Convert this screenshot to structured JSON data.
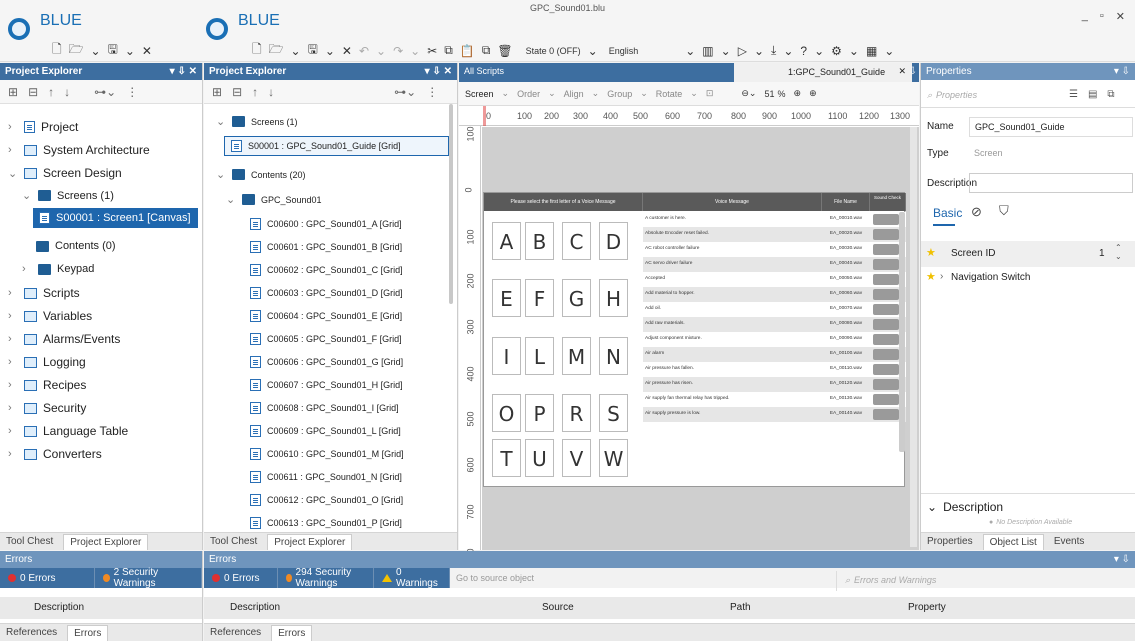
{
  "window": {
    "title": "GPC_Sound01.blu",
    "controls": [
      "_",
      "▫",
      "✕"
    ]
  },
  "brand": {
    "name": "BLUE"
  },
  "toolbar": {
    "state": "State 0 (OFF)",
    "language": "English"
  },
  "left_panel": {
    "title": "Project Explorer",
    "items": [
      {
        "label": "Project"
      },
      {
        "label": "System Architecture"
      },
      {
        "label": "Screen Design"
      },
      {
        "label": "Screens (1)"
      },
      {
        "label": "S00001 : Screen1 [Canvas]"
      },
      {
        "label": "Contents (0)"
      },
      {
        "label": "Keypad"
      },
      {
        "label": "Scripts"
      },
      {
        "label": "Variables"
      },
      {
        "label": "Alarms/Events"
      },
      {
        "label": "Logging"
      },
      {
        "label": "Recipes"
      },
      {
        "label": "Security"
      },
      {
        "label": "Language Table"
      },
      {
        "label": "Converters"
      }
    ],
    "tabs": [
      "Tool Chest",
      "Project Explorer"
    ]
  },
  "mid_panel": {
    "title": "Project Explorer",
    "screens": "Screens (1)",
    "screen_item": "S00001 : GPC_Sound01_Guide [Grid]",
    "contents": "Contents (20)",
    "group": "GPC_Sound01",
    "items": [
      "C00600 : GPC_Sound01_A [Grid]",
      "C00601 : GPC_Sound01_B [Grid]",
      "C00602 : GPC_Sound01_C [Grid]",
      "C00603 : GPC_Sound01_D [Grid]",
      "C00604 : GPC_Sound01_E [Grid]",
      "C00605 : GPC_Sound01_F [Grid]",
      "C00606 : GPC_Sound01_G [Grid]",
      "C00607 : GPC_Sound01_H [Grid]",
      "C00608 : GPC_Sound01_I [Grid]",
      "C00609 : GPC_Sound01_L [Grid]",
      "C00610 : GPC_Sound01_M [Grid]",
      "C00611 : GPC_Sound01_N [Grid]",
      "C00612 : GPC_Sound01_O [Grid]",
      "C00613 : GPC_Sound01_P [Grid]"
    ],
    "tabs": [
      "Tool Chest",
      "Project Explorer"
    ]
  },
  "editor": {
    "tab_all": "All Scripts",
    "tab_active": "1:GPC_Sound01_Guide",
    "toolbar": {
      "screen": "Screen",
      "order": "Order",
      "align": "Align",
      "group": "Group",
      "rotate": "Rotate",
      "zoom": "51",
      "zoom_unit": "%"
    },
    "hruler": [
      "0",
      "100",
      "200",
      "300",
      "400",
      "500",
      "600",
      "700",
      "800",
      "900",
      "1000",
      "1100",
      "1200",
      "1300"
    ],
    "vruler": [
      "100",
      "0",
      "100",
      "200",
      "300",
      "400",
      "500",
      "600",
      "700",
      "800"
    ],
    "grid": {
      "headers": [
        "Please select the first letter of a Voice Message",
        "Voice Message",
        "File Name",
        "Sound Check"
      ],
      "letters": [
        "A",
        "B",
        "C",
        "D",
        "E",
        "F",
        "G",
        "H",
        "I",
        "L",
        "M",
        "N",
        "O",
        "P",
        "R",
        "S",
        "T",
        "U",
        "V",
        "W"
      ],
      "messages": [
        {
          "msg": "A customer is here.",
          "file": "EA_00010.wav"
        },
        {
          "msg": "Absolute Encoder reset failed.",
          "file": "EA_00020.wav"
        },
        {
          "msg": "AC robot controller failure",
          "file": "EA_00030.wav"
        },
        {
          "msg": "AC servo driver failure",
          "file": "EA_00040.wav"
        },
        {
          "msg": "Accepted",
          "file": "EA_00050.wav"
        },
        {
          "msg": "Add material to hopper.",
          "file": "EA_00060.wav"
        },
        {
          "msg": "Add oil.",
          "file": "EA_00070.wav"
        },
        {
          "msg": "Add raw materials.",
          "file": "EA_00080.wav"
        },
        {
          "msg": "Adjust component mixture.",
          "file": "EA_00090.wav"
        },
        {
          "msg": "Air alarm",
          "file": "EA_00100.wav"
        },
        {
          "msg": "Air pressure has fallen.",
          "file": "EA_00110.wav"
        },
        {
          "msg": "Air pressure has risen.",
          "file": "EA_00120.wav"
        },
        {
          "msg": "Air supply fan thermal relay has tripped.",
          "file": "EA_00130.wav"
        },
        {
          "msg": "Air supply pressure is low.",
          "file": "EA_00140.wav"
        }
      ]
    }
  },
  "properties": {
    "title": "Properties",
    "search_placeholder": "Properties",
    "name_label": "Name",
    "name_value": "GPC_Sound01_Guide",
    "type_label": "Type",
    "type_value": "Screen",
    "desc_label": "Description",
    "basic_tab": "Basic",
    "screen_id_label": "Screen ID",
    "screen_id_value": "1",
    "nav_switch_label": "Navigation Switch",
    "desc_section": "Description",
    "no_desc": "No Description Available",
    "tabs": [
      "Properties",
      "Object List",
      "Events"
    ]
  },
  "errors_left": {
    "title": "Errors",
    "errors": "0 Errors",
    "security": "2 Security Warnings",
    "col": "Description",
    "tabs": [
      "References",
      "Errors"
    ]
  },
  "errors_main": {
    "title": "Errors",
    "errors": "0 Errors",
    "security": "294 Security Warnings",
    "warnings": "0 Warnings",
    "goto": "Go to source object",
    "search_placeholder": "Errors and Warnings",
    "cols": [
      "Description",
      "Source",
      "Path",
      "Property"
    ],
    "tabs": [
      "References",
      "Errors"
    ]
  },
  "colors": {
    "accent": "#1e66ad",
    "panel_title": "#3d6ea0",
    "security": "#f08a24",
    "error": "#e03030"
  }
}
